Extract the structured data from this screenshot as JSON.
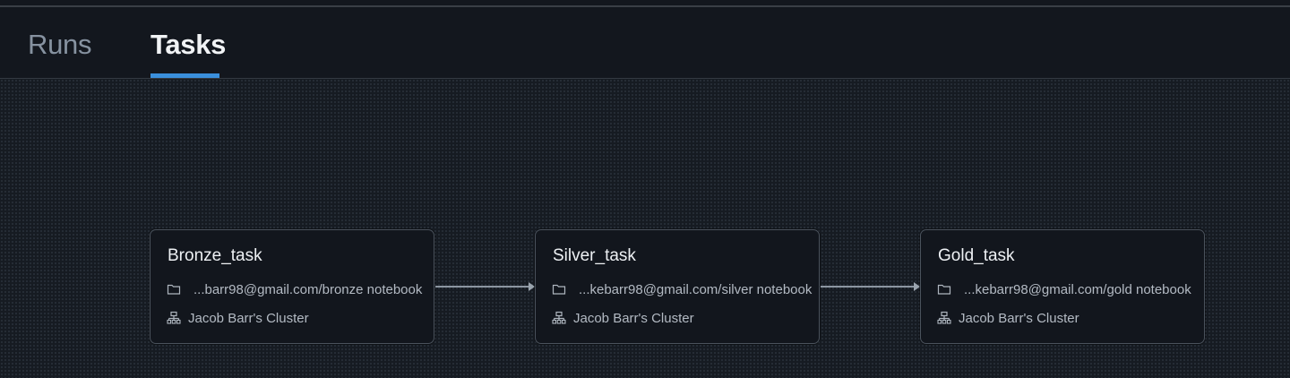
{
  "tabs": [
    {
      "label": "Runs",
      "active": false
    },
    {
      "label": "Tasks",
      "active": true
    }
  ],
  "colors": {
    "background": "#13171e",
    "active_tab_underline": "#3a8fdc",
    "node_border": "#4a525c",
    "edge": "#8c96a1"
  },
  "nodes": [
    {
      "title": "Bronze_task",
      "notebook_icon": "folder-icon",
      "notebook": "...barr98@gmail.com/bronze notebook",
      "cluster_icon": "cluster-icon",
      "cluster": "Jacob Barr's Cluster"
    },
    {
      "title": "Silver_task",
      "notebook_icon": "folder-icon",
      "notebook": "...kebarr98@gmail.com/silver notebook",
      "cluster_icon": "cluster-icon",
      "cluster": "Jacob Barr's Cluster"
    },
    {
      "title": "Gold_task",
      "notebook_icon": "folder-icon",
      "notebook": "...kebarr98@gmail.com/gold notebook",
      "cluster_icon": "cluster-icon",
      "cluster": "Jacob Barr's Cluster"
    }
  ],
  "edges": [
    {
      "from": "Bronze_task",
      "to": "Silver_task"
    },
    {
      "from": "Silver_task",
      "to": "Gold_task"
    }
  ]
}
